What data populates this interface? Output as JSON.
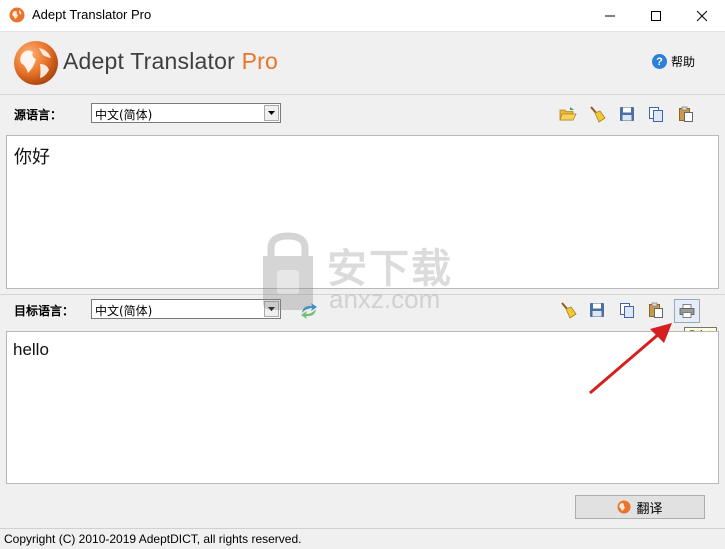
{
  "window": {
    "title": "Adept Translator Pro"
  },
  "header": {
    "brand_main": "Adept Translator ",
    "brand_accent": "Pro",
    "help_label": "帮助",
    "help_glyph": "?"
  },
  "source": {
    "label": "源语言：",
    "language": "中文(简体)",
    "text": "你好"
  },
  "target": {
    "label": "目标语言：",
    "language": "中文(简体)",
    "text": "hello"
  },
  "tooltip": {
    "print": "Print"
  },
  "actions": {
    "translate_label": "翻译"
  },
  "watermark": {
    "cn": "安下载",
    "en": "anxz.com"
  },
  "status": {
    "copyright": "Copyright (C) 2010-2019 AdeptDICT, all rights reserved."
  },
  "colors": {
    "brand_orange": "#e8752a",
    "annotation_arrow": "#d42020",
    "tooltip_bg": "#ffffe1"
  }
}
